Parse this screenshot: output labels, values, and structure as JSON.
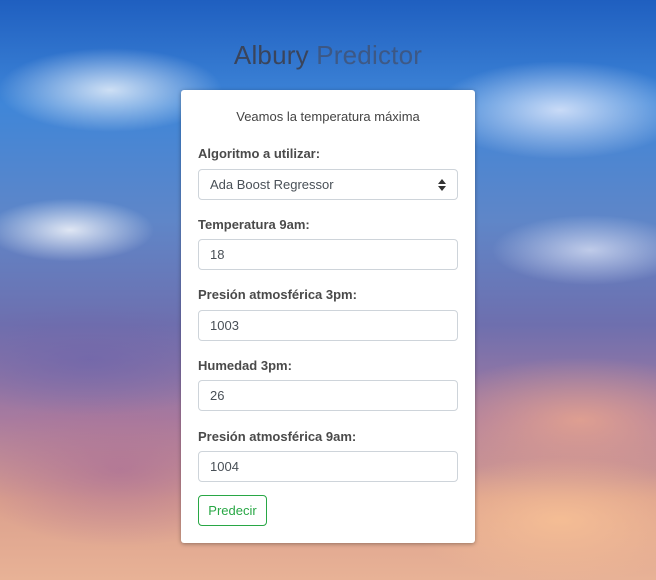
{
  "app": {
    "title_part1": "Albury",
    "title_part2": "Predictor"
  },
  "form": {
    "subtitle": "Veamos la temperatura máxima",
    "algorithm": {
      "label": "Algoritmo a utilizar:",
      "selected": "Ada Boost Regressor"
    },
    "temp_9am": {
      "label": "Temperatura 9am:",
      "value": "18"
    },
    "pressure_3pm": {
      "label": "Presión atmosférica 3pm:",
      "value": "1003"
    },
    "humidity_3pm": {
      "label": "Humedad 3pm:",
      "value": "26"
    },
    "pressure_9am": {
      "label": "Presión atmosférica 9am:",
      "value": "1004"
    },
    "submit_label": "Predecir"
  },
  "colors": {
    "submit_accent": "#28a745",
    "card_background": "#ffffff"
  },
  "icons": {
    "select_arrows": "sort-arrows-icon"
  }
}
